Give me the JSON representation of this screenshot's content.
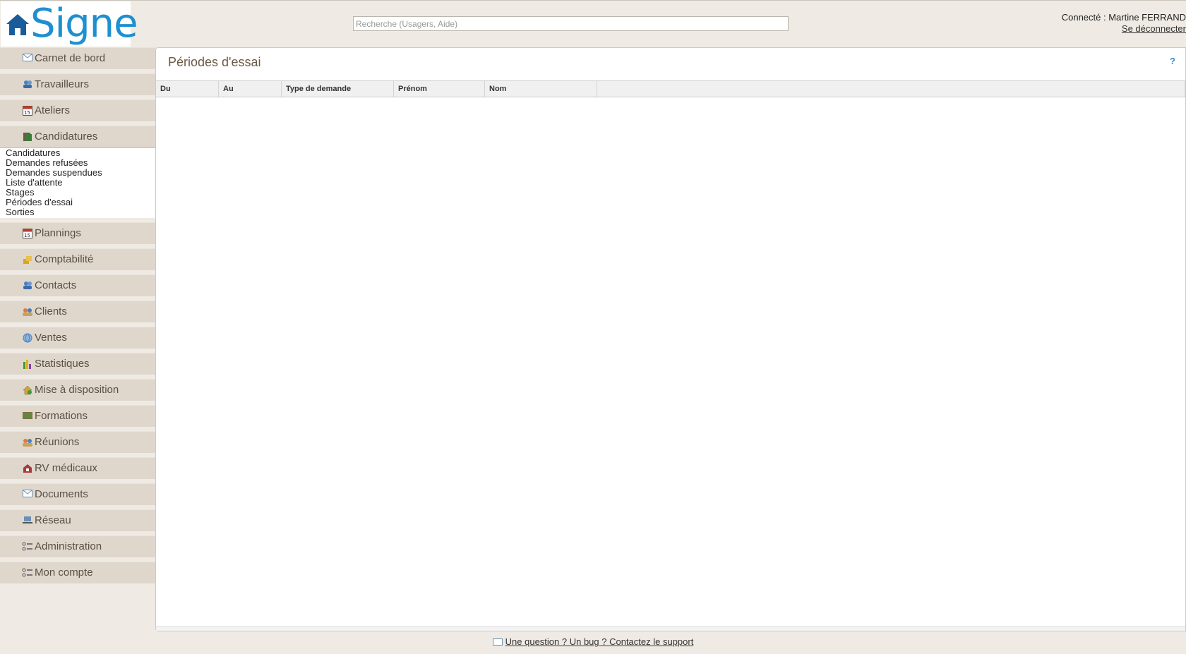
{
  "app": {
    "logo_text": "Signe"
  },
  "header": {
    "search_placeholder": "Recherche (Usagers, Aide)",
    "connected_label": "Connecté : Martine FERRAND",
    "logout_label": "Se déconnecter"
  },
  "sidebar": {
    "items": [
      {
        "label": "Carnet de bord",
        "icon": "envelope-icon"
      },
      {
        "label": "Travailleurs",
        "icon": "users-icon"
      },
      {
        "label": "Ateliers",
        "icon": "calendar-icon"
      },
      {
        "label": "Candidatures",
        "icon": "folder-icon"
      },
      {
        "label": "Plannings",
        "icon": "calendar-icon"
      },
      {
        "label": "Comptabilité",
        "icon": "coins-icon"
      },
      {
        "label": "Contacts",
        "icon": "users-icon"
      },
      {
        "label": "Clients",
        "icon": "people-icon"
      },
      {
        "label": "Ventes",
        "icon": "globe-icon"
      },
      {
        "label": "Statistiques",
        "icon": "bar-chart-icon"
      },
      {
        "label": "Mise à disposition",
        "icon": "house-icon"
      },
      {
        "label": "Formations",
        "icon": "board-icon"
      },
      {
        "label": "Réunions",
        "icon": "people-icon"
      },
      {
        "label": "RV médicaux",
        "icon": "medical-icon"
      },
      {
        "label": "Documents",
        "icon": "envelope-icon"
      },
      {
        "label": "Réseau",
        "icon": "network-icon"
      },
      {
        "label": "Administration",
        "icon": "settings-list-icon"
      },
      {
        "label": "Mon compte",
        "icon": "settings-list-icon"
      }
    ],
    "submenu": [
      "Candidatures",
      "Demandes refusées",
      "Demandes suspendues",
      "Liste d'attente",
      "Stages",
      "Périodes d'essai",
      "Sorties"
    ]
  },
  "main": {
    "title": "Périodes d'essai",
    "help_label": "?",
    "columns": [
      "Du",
      "Au",
      "Type de demande",
      "Prénom",
      "Nom"
    ]
  },
  "footer": {
    "support_link": "Une question ? Un bug ? Contactez le support"
  },
  "colors": {
    "accent": "#1e8fd0",
    "sidebar_bg": "#dfd7cc",
    "page_bg": "#efebe4",
    "title": "#6b5a45"
  }
}
